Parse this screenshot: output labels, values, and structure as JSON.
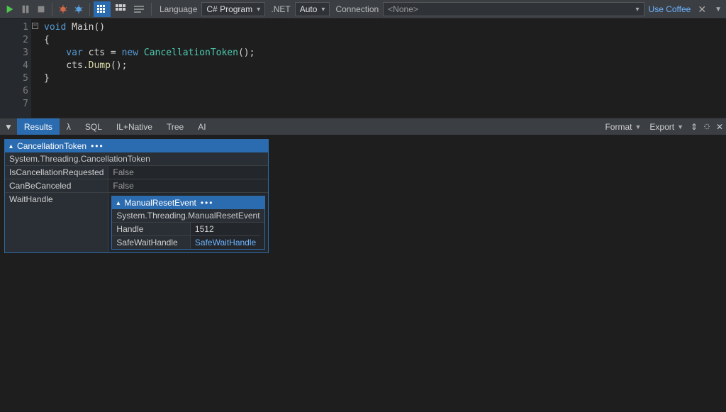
{
  "toolbar": {
    "language_label": "Language",
    "language_value": "C# Program",
    "net_label": ".NET",
    "net_value": "Auto",
    "connection_label": "Connection",
    "connection_value": "<None>",
    "coffee_label": "Use Coffee"
  },
  "code": {
    "l1a": "void",
    "l1b": " Main()",
    "l2": "{",
    "l3a": "    var",
    "l3b": " cts = ",
    "l3c": "new",
    "l3d": " CancellationToken",
    "l3e": "();",
    "l4a": "    cts.",
    "l4b": "Dump",
    "l4c": "();",
    "l5": "}"
  },
  "lines": {
    "1": "1",
    "2": "2",
    "3": "3",
    "4": "4",
    "5": "5",
    "6": "6",
    "7": "7"
  },
  "res_tabs": {
    "results": "Results",
    "lambda": "λ",
    "sql": "SQL",
    "ilnative": "IL+Native",
    "tree": "Tree",
    "ai": "AI"
  },
  "res_actions": {
    "format": "Format",
    "export": "Export"
  },
  "dump1": {
    "title": "CancellationToken",
    "dots": "•••",
    "sub": "System.Threading.CancellationToken",
    "rows": {
      "k1": "IsCancellationRequested",
      "v1": "False",
      "k2": "CanBeCanceled",
      "v2": "False",
      "k3": "WaitHandle"
    }
  },
  "dump2": {
    "title": "ManualResetEvent",
    "dots": "•••",
    "sub": "System.Threading.ManualResetEvent",
    "rows": {
      "k1": "Handle",
      "v1": "1512",
      "k2": "SafeWaitHandle",
      "v2": "SafeWaitHandle"
    }
  }
}
